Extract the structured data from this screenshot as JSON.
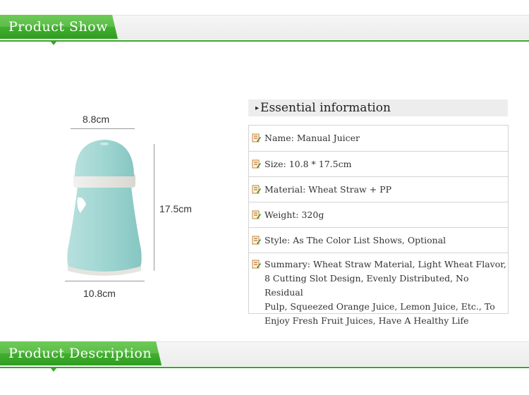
{
  "sections": {
    "product_show": "Product Show",
    "product_description": "Product Description"
  },
  "product": {
    "top_width": "8.8cm",
    "height": "17.5cm",
    "bottom_width": "10.8cm",
    "body_color": "#9fd6d3",
    "band_color": "#e9e7e2"
  },
  "info": {
    "heading": "Essential information",
    "rows": [
      {
        "text": "Name: Manual Juicer"
      },
      {
        "text": "Size: 10.8 * 17.5cm"
      },
      {
        "text": "Material: Wheat Straw + PP"
      },
      {
        "text": "Weight: 320g"
      },
      {
        "text": "Style: As The Color List Shows, Optional"
      },
      {
        "lines": [
          "Summary: Wheat Straw Material, Light Wheat Flavor,",
          "8 Cutting Slot Design, Evenly Distributed, No Residual",
          "Pulp, Squeezed Orange Juice, Lemon Juice, Etc., To",
          "Enjoy Fresh Fruit Juices, Have A Healthy Life"
        ]
      }
    ]
  },
  "icons": {
    "row_icon": "note-pencil-icon",
    "heading_icon": "triangle-right-icon"
  },
  "colors": {
    "accent": "#3aa52a",
    "tab_top": "#55c43a",
    "tab_bottom": "#2f9c22"
  }
}
